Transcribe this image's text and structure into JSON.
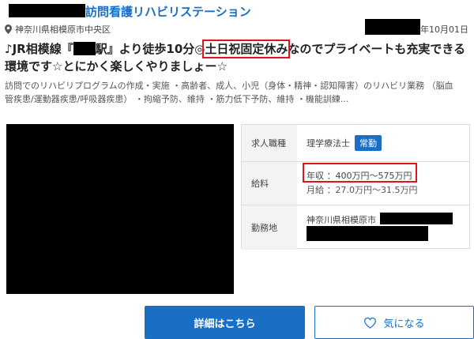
{
  "header": {
    "facility_name": "訪問看護リハビリステーション",
    "location": "神奈川県相模原市中央区",
    "date_suffix": "年10月01日"
  },
  "headline": {
    "part1": "♪JR相模線『",
    "part2": "駅』より徒歩10分◎",
    "highlight": "土日祝固定休み",
    "part3": "なのでプライベートも充実できる",
    "line2": "環境です☆とにかく楽しくやりましょー☆"
  },
  "description": {
    "line1": "訪問でのリハビリプログラムの作成・実施 ・高齢者、成人、小児（身体・精神・認知障害）のリハビリ業務 （脳血",
    "line2": "管疾患/運動器疾患/呼吸器疾患） ・拘縮予防、維持 ・筋力低下予防、維持 ・機能訓練..."
  },
  "details": {
    "job_type_label": "求人職種",
    "job_type_value": "理学療法士",
    "employment_badge": "常勤",
    "salary_label": "給料",
    "salary_annual": "年収 ：400万円～575万円",
    "salary_monthly": "月給 ：27.0万円～31.5万円",
    "workplace_label": "勤務地",
    "workplace_value": "神奈川県相模原市"
  },
  "buttons": {
    "detail_label": "詳細はこちら",
    "favorite_label": "気になる"
  },
  "icons": {
    "location": "pin-icon",
    "favorite": "heart-icon"
  },
  "colors": {
    "accent": "#1a6fc4",
    "highlight_border": "#e0141e"
  }
}
